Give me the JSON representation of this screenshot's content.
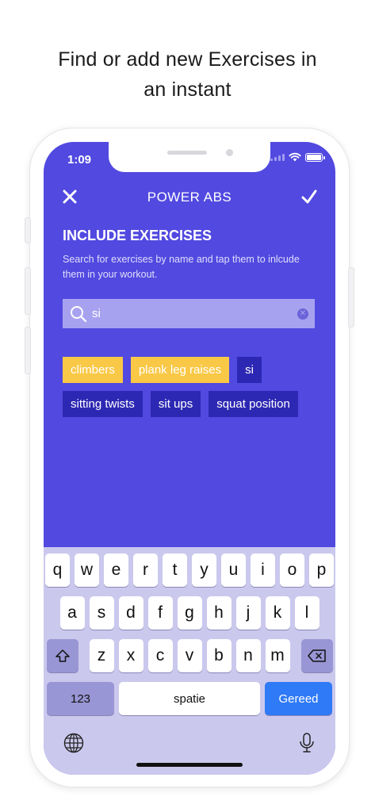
{
  "headline": {
    "line1": "Find or add new Exercises in",
    "line2": "an instant"
  },
  "status_bar": {
    "time": "1:09"
  },
  "nav": {
    "title": "POWER ABS"
  },
  "section": {
    "title": "INCLUDE EXERCISES",
    "description": "Search for exercises by name and tap them to inlcude them in your workout."
  },
  "search": {
    "value": "si",
    "placeholder": ""
  },
  "chips": [
    {
      "label": "climbers",
      "selected": true
    },
    {
      "label": "plank leg raises",
      "selected": true
    },
    {
      "label": "si",
      "selected": false
    },
    {
      "label": "sitting twists",
      "selected": false
    },
    {
      "label": "sit ups",
      "selected": false
    },
    {
      "label": "squat position",
      "selected": false
    }
  ],
  "keyboard": {
    "row1": [
      "q",
      "w",
      "e",
      "r",
      "t",
      "y",
      "u",
      "i",
      "o",
      "p"
    ],
    "row2": [
      "a",
      "s",
      "d",
      "f",
      "g",
      "h",
      "j",
      "k",
      "l"
    ],
    "row3": [
      "z",
      "x",
      "c",
      "v",
      "b",
      "n",
      "m"
    ],
    "numbers_label": "123",
    "space_label": "spatie",
    "done_label": "Gereed"
  },
  "colors": {
    "primary": "#5149e0",
    "chip_selected": "#f9c846",
    "chip_default": "#2d28b3",
    "keyboard_bg": "#cbc8ee",
    "done_key": "#2f7af6"
  },
  "icons": {
    "close": "close-icon",
    "done": "checkmark-icon",
    "search": "search-icon",
    "clear": "clear-icon",
    "shift": "shift-icon",
    "backspace": "backspace-icon",
    "globe": "globe-icon",
    "mic": "microphone-icon"
  }
}
